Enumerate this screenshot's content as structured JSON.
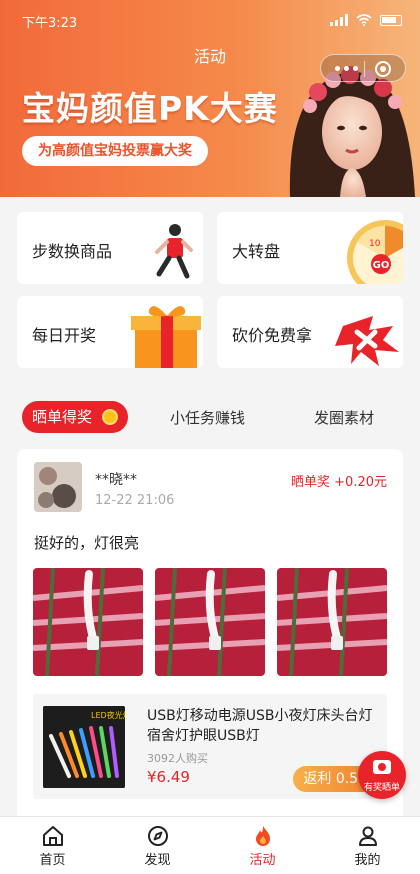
{
  "status_bar": {
    "time": "下午3:23"
  },
  "header": {
    "title": "活动"
  },
  "banner": {
    "headline": "宝妈颜值PK大赛",
    "subtitle": "为高颜值宝妈投票赢大奖"
  },
  "grid": [
    {
      "label": "步数换商品"
    },
    {
      "label": "大转盘"
    },
    {
      "label": "每日开奖"
    },
    {
      "label": "砍价免费拿"
    }
  ],
  "tabs": {
    "active": "晒单得奖",
    "others": [
      "小任务赚钱",
      "发圈素材"
    ]
  },
  "post": {
    "username": "**晓**",
    "time": "12-22 21:06",
    "reward": "晒单奖 +0.20元",
    "text": "挺好的，灯很亮",
    "product": {
      "title": "USB灯移动电源USB小夜灯床头台灯宿舍灯护眼USB灯",
      "sold": "3092人购买",
      "price": "¥6.49",
      "rebate": "返利 0.58",
      "thumb_label": "LED夜光灯"
    }
  },
  "fab": {
    "label": "有奖晒单"
  },
  "bottom_nav": [
    {
      "label": "首页",
      "icon": "home-icon"
    },
    {
      "label": "发现",
      "icon": "compass-icon"
    },
    {
      "label": "活动",
      "icon": "flame-icon"
    },
    {
      "label": "我的",
      "icon": "user-icon"
    }
  ],
  "colors": {
    "accent": "#e8242a",
    "banner_start": "#f26a3a",
    "banner_end": "#f6b57a"
  }
}
